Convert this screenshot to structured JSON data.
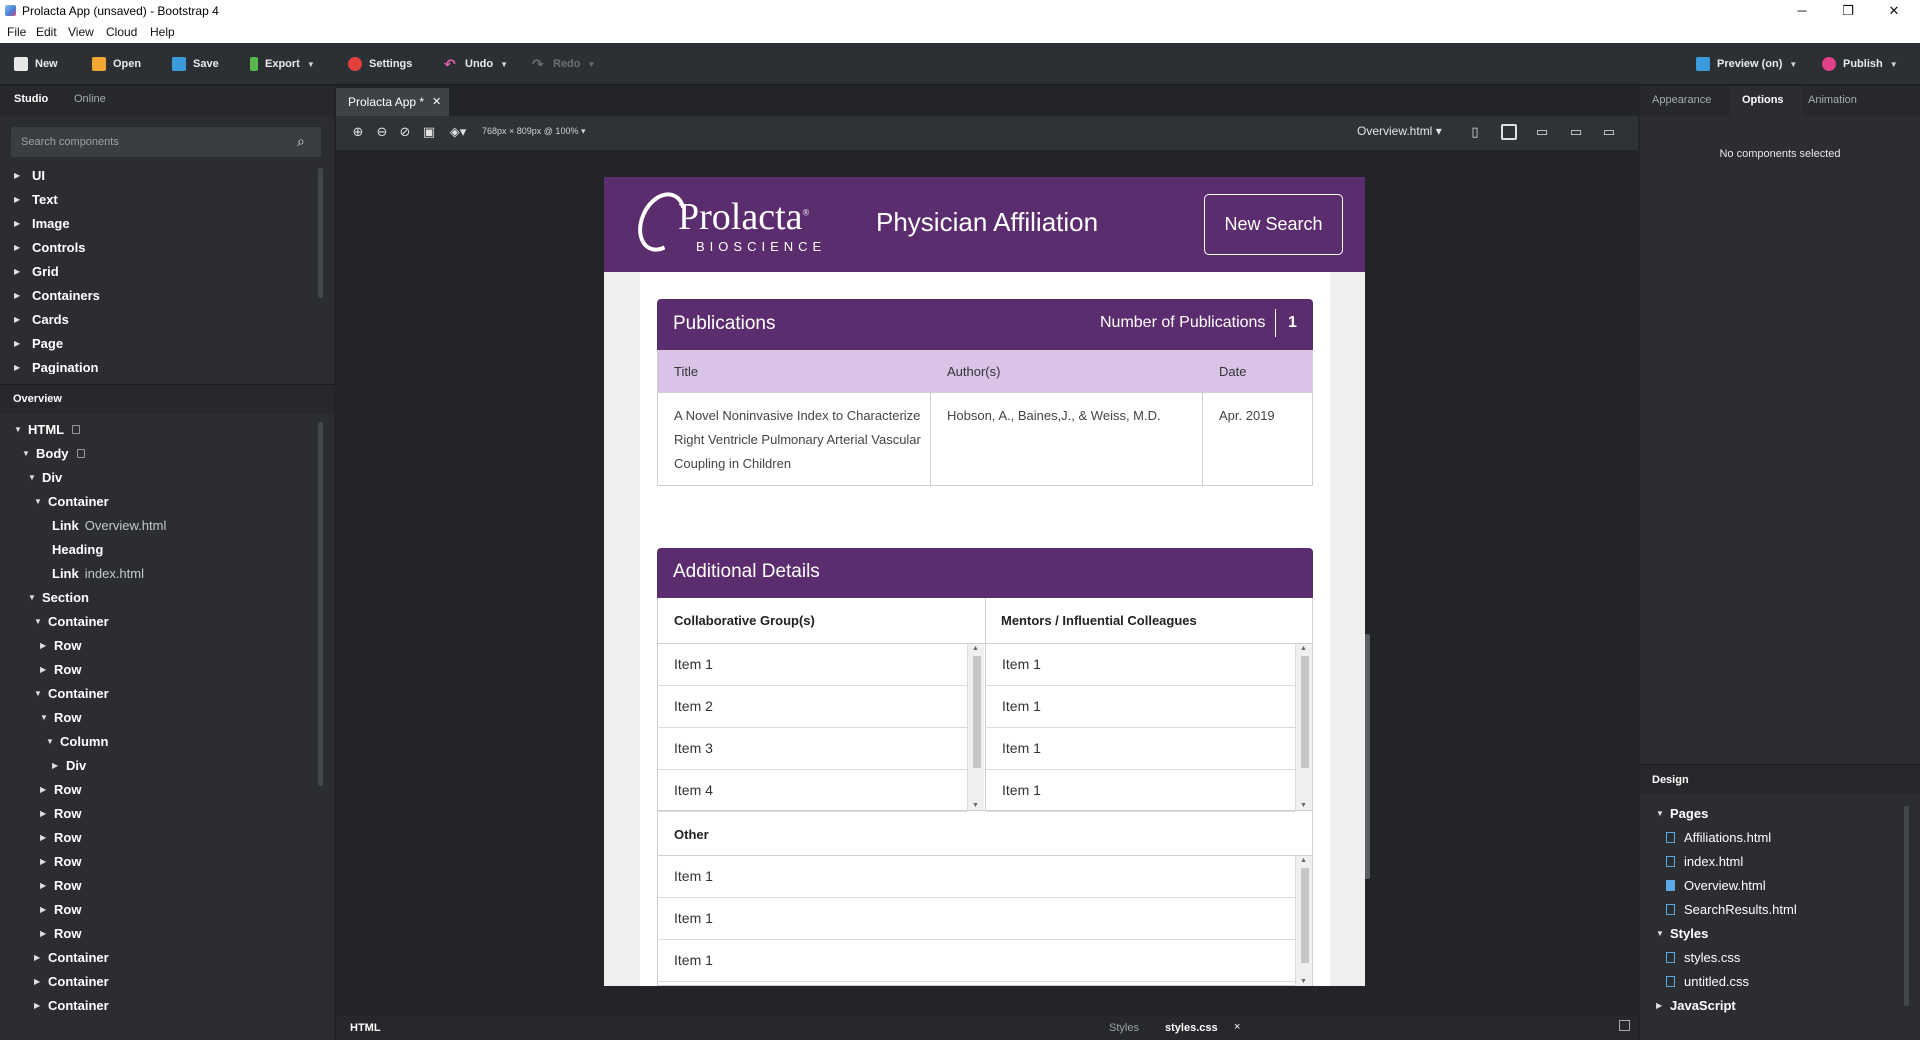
{
  "window": {
    "title": "Prolacta App (unsaved) - Bootstrap 4",
    "minimize": "─",
    "maximize": "❐",
    "close": "✕"
  },
  "menu": [
    "File",
    "Edit",
    "View",
    "Cloud",
    "Help"
  ],
  "toolbar": {
    "new": "New",
    "open": "Open",
    "save": "Save",
    "export": "Export",
    "settings": "Settings",
    "undo": "Undo",
    "redo": "Redo",
    "preview": "Preview (on)",
    "publish": "Publish"
  },
  "left": {
    "tabs": [
      "Studio",
      "Online"
    ],
    "search_placeholder": "Search components",
    "components": [
      "UI",
      "Text",
      "Image",
      "Controls",
      "Grid",
      "Containers",
      "Cards",
      "Page",
      "Pagination"
    ],
    "overview_tab": "Overview",
    "tree": [
      {
        "label": "HTML",
        "open": true
      },
      {
        "label": "Body",
        "open": true
      },
      {
        "label": "Div",
        "open": true
      },
      {
        "label": "Container",
        "open": true
      },
      {
        "label": "Link",
        "sub": "Overview.html"
      },
      {
        "label": "Heading"
      },
      {
        "label": "Link",
        "sub": "index.html"
      },
      {
        "label": "Section",
        "open": true
      },
      {
        "label": "Container",
        "open": true
      },
      {
        "label": "Row"
      },
      {
        "label": "Row"
      },
      {
        "label": "Container",
        "open": true
      },
      {
        "label": "Row",
        "open": true
      },
      {
        "label": "Column",
        "open": true
      },
      {
        "label": "Div"
      },
      {
        "label": "Row"
      },
      {
        "label": "Row"
      },
      {
        "label": "Row"
      },
      {
        "label": "Row"
      },
      {
        "label": "Row"
      },
      {
        "label": "Row"
      },
      {
        "label": "Row"
      },
      {
        "label": "Container"
      },
      {
        "label": "Container"
      },
      {
        "label": "Container"
      }
    ]
  },
  "canvas": {
    "doc_tab": "Prolacta App *",
    "size_label": "768px × 809px @ 100%",
    "page_select": "Overview.html"
  },
  "page": {
    "logo_main": "Prolacta",
    "logo_sub": "BIOSCIENCE",
    "logo_mark": "®",
    "header_title": "Physician Affiliation",
    "new_search": "New Search",
    "pubs": {
      "title": "Publications",
      "count_label": "Number of Publications",
      "count": "1",
      "columns": [
        "Title",
        "Author(s)",
        "Date"
      ],
      "row": {
        "title": "A Novel Noninvasive Index to Characterize Right Ventricle Pulmonary Arterial Vascular Coupling in Children",
        "authors": "Hobson, A., Baines,J., & Weiss, M.D.",
        "date": "Apr. 2019"
      }
    },
    "details": {
      "title": "Additional Details",
      "col1": "Collaborative Group(s)",
      "col2": "Mentors / Influential Colleagues",
      "col1_items": [
        "Item 1",
        "Item 2",
        "Item 3",
        "Item 4"
      ],
      "col2_items": [
        "Item 1",
        "Item 1",
        "Item 1",
        "Item 1"
      ],
      "other": "Other",
      "other_items": [
        "Item 1",
        "Item 1",
        "Item 1"
      ]
    }
  },
  "right": {
    "tabs": [
      "Appearance",
      "Options",
      "Animation"
    ],
    "empty": "No components selected",
    "design_tab": "Design",
    "pages_label": "Pages",
    "pages": [
      "Affiliations.html",
      "index.html",
      "Overview.html",
      "SearchResults.html"
    ],
    "styles_label": "Styles",
    "styles": [
      "styles.css",
      "untitled.css"
    ],
    "js_label": "JavaScript"
  },
  "bottom": {
    "html": "HTML",
    "styles": "Styles",
    "stylescss": "styles.css",
    "close": "×"
  },
  "colors": {
    "brand": "#5c2d6e",
    "header_row": "#d9c4e8"
  }
}
